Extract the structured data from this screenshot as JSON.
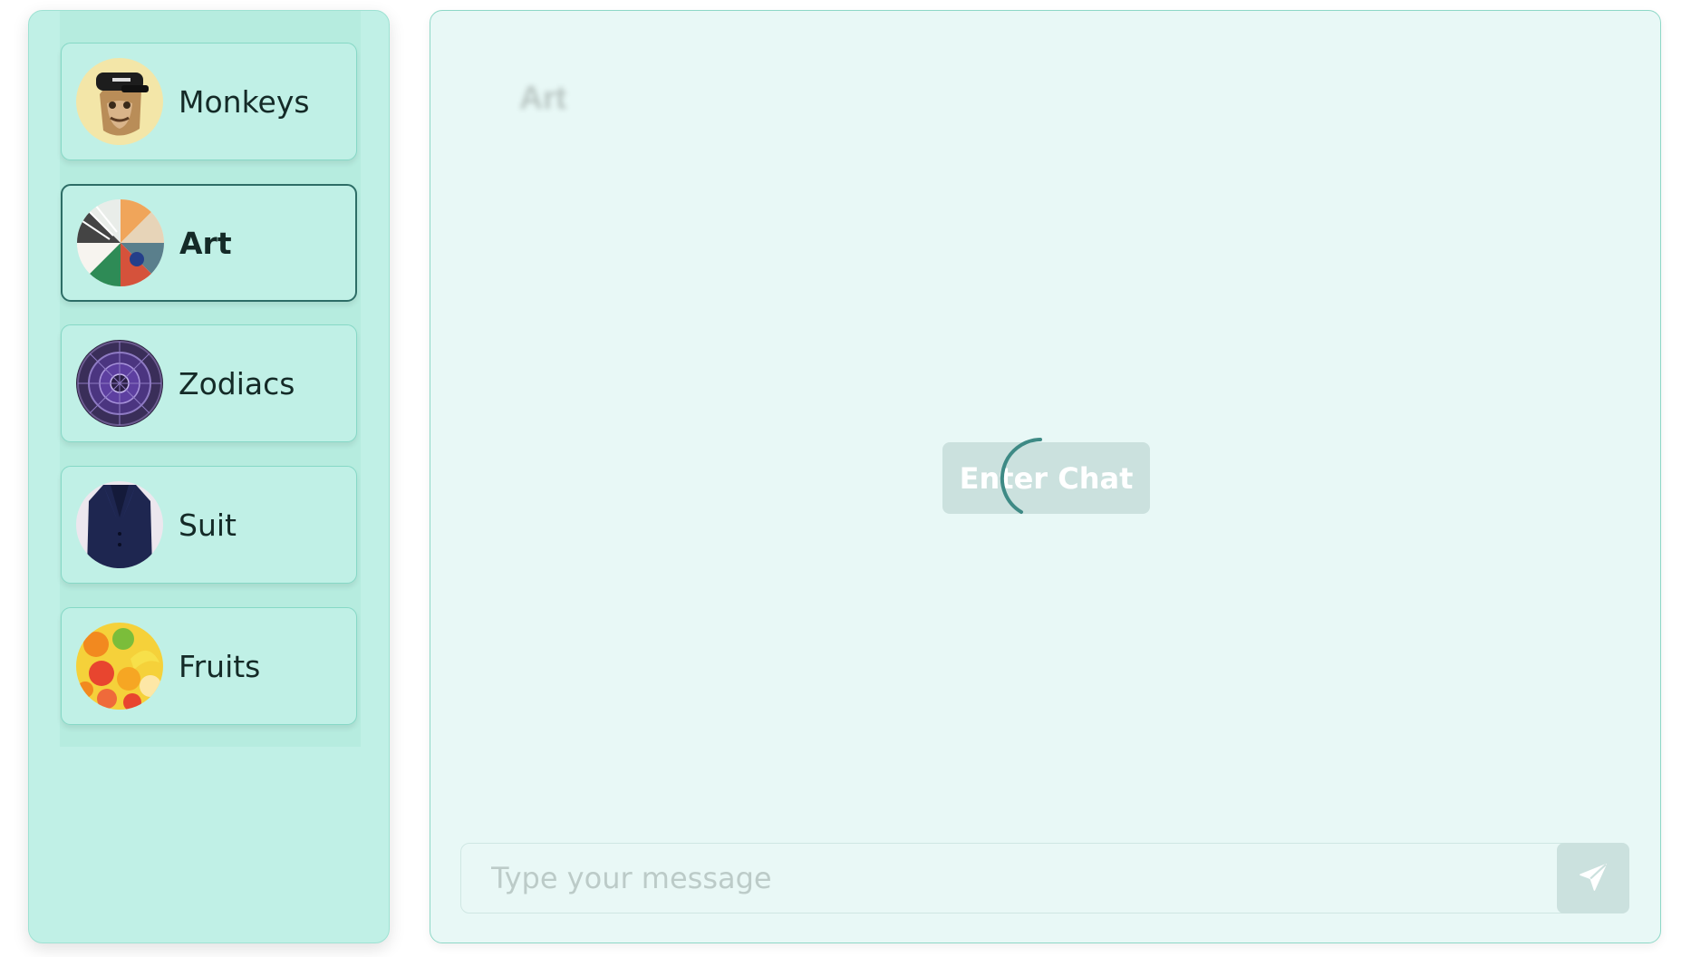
{
  "sidebar": {
    "rooms": [
      {
        "label": "Monkeys",
        "icon": "ape-avatar-icon"
      },
      {
        "label": "Art",
        "icon": "art-collage-icon",
        "active": true
      },
      {
        "label": "Zodiacs",
        "icon": "zodiac-wheel-icon"
      },
      {
        "label": "Suit",
        "icon": "suit-jacket-icon"
      },
      {
        "label": "Fruits",
        "icon": "fruits-icon"
      }
    ]
  },
  "chat": {
    "title": "Art",
    "enter_button": "Enter Chat",
    "input_placeholder": "Type your message",
    "send_icon": "send-icon"
  },
  "colors": {
    "sidebar_bg": "#c0f0e6",
    "chat_bg": "#e8f8f6",
    "active_border": "#2d6d66",
    "button_bg": "#cbe1de",
    "spinner": "#3e8a85"
  }
}
